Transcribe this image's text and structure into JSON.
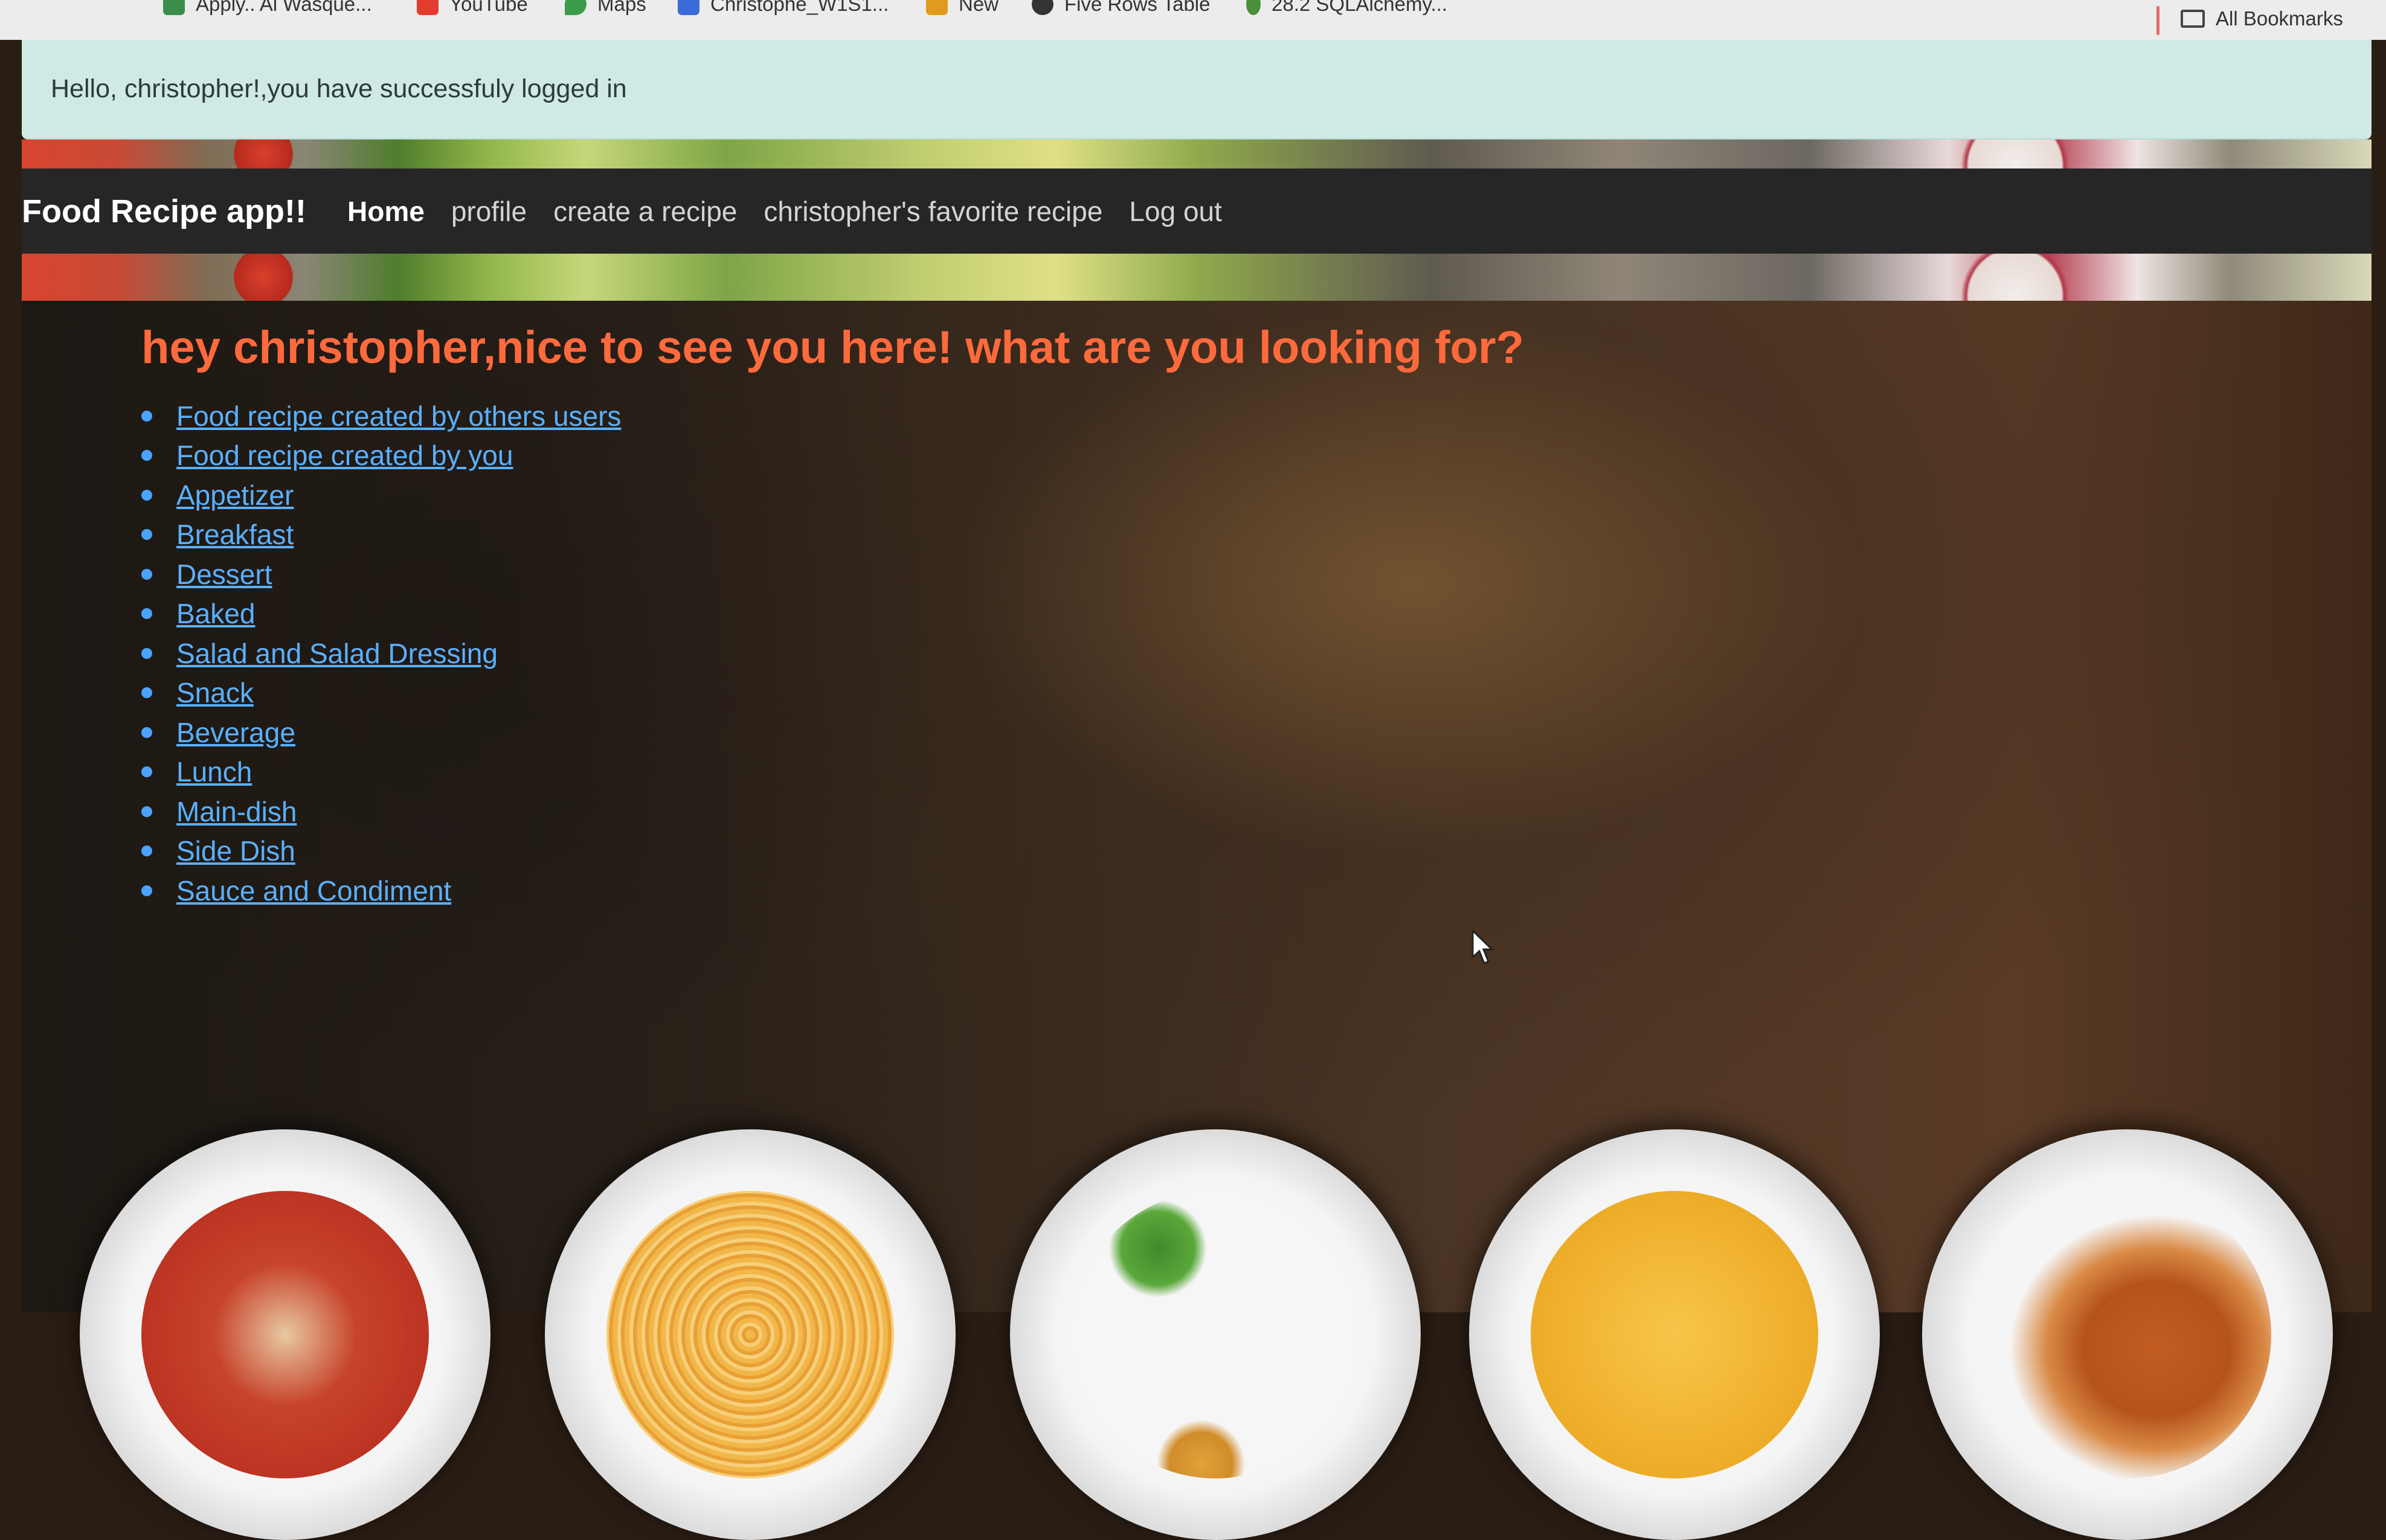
{
  "bookmarks": {
    "items": [
      {
        "label": "Apply.. Al Wasque..."
      },
      {
        "label": "YouTube"
      },
      {
        "label": "Maps"
      },
      {
        "label": "Christophe_W1S1..."
      },
      {
        "label": "New"
      },
      {
        "label": "Five Rows Table"
      },
      {
        "label": "28.2 SQLAlchemy..."
      }
    ],
    "all_bookmarks": "All Bookmarks"
  },
  "flash": {
    "message": "Hello, christopher!,you have successfuly logged in"
  },
  "navbar": {
    "brand": "Food Recipe app!!",
    "links": [
      {
        "label": "Home"
      },
      {
        "label": "profile"
      },
      {
        "label": "create a recipe"
      },
      {
        "label": "christopher's favorite recipe"
      },
      {
        "label": "Log out"
      }
    ]
  },
  "main": {
    "greeting": "hey christopher,nice to see you here! what are you looking for?",
    "categories": [
      "Food recipe created by others users",
      "Food recipe created by you",
      "Appetizer",
      "Breakfast",
      "Dessert",
      "Baked",
      "Salad and Salad Dressing",
      "Snack",
      "Beverage",
      "Lunch",
      "Main-dish",
      "Side Dish",
      "Sauce and Condiment"
    ]
  },
  "colors": {
    "greeting": "#ff6a3d",
    "link": "#5ab0ff",
    "navbar": "#262626",
    "flash_bg": "#cfe9e4"
  },
  "plates": [
    {
      "icon": "tomato-soup-plate"
    },
    {
      "icon": "pasta-plate"
    },
    {
      "icon": "basil-dish-plate"
    },
    {
      "icon": "yellow-soup-plate"
    },
    {
      "icon": "croissant-plate"
    }
  ]
}
